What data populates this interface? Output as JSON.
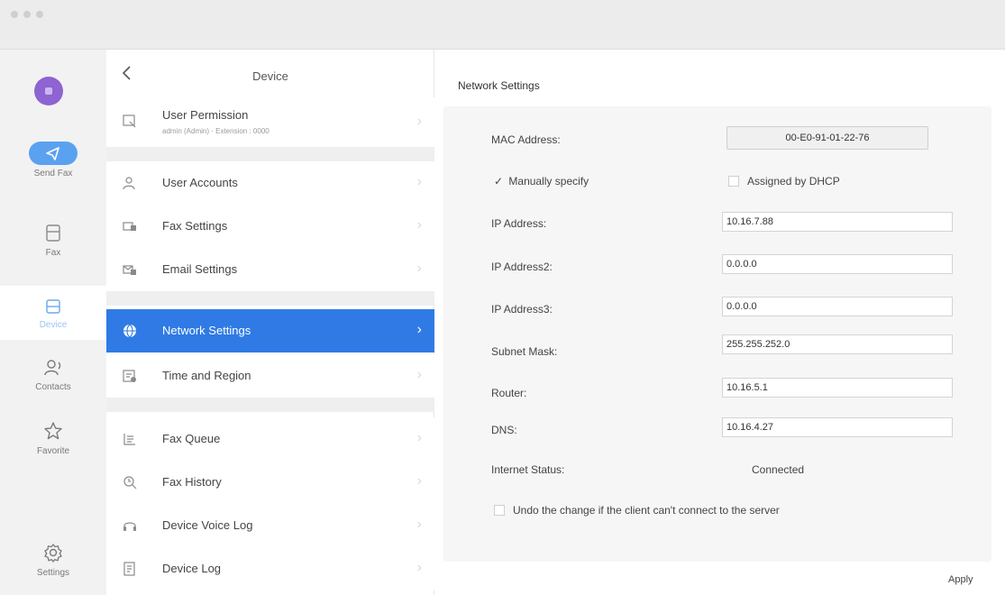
{
  "rail": {
    "send_fax": "Send Fax",
    "fax": "Fax",
    "device": "Device",
    "contacts": "Contacts",
    "favorite": "Favorite",
    "settings": "Settings"
  },
  "menu": {
    "title": "Device",
    "back_icon": "chevron-left-icon",
    "user_permission": {
      "label": "User Permission",
      "sub": "admin (Admin) · Extension : 0000"
    },
    "items": [
      {
        "label": "User Accounts",
        "icon": "user-icon"
      },
      {
        "label": "Fax Settings",
        "icon": "fax-settings-icon"
      },
      {
        "label": "Email Settings",
        "icon": "email-icon"
      },
      {
        "label": "Network Settings",
        "icon": "globe-icon",
        "selected": true
      },
      {
        "label": "Time and Region",
        "icon": "clock-icon"
      },
      {
        "label": "Fax Queue",
        "icon": "queue-icon"
      },
      {
        "label": "Fax History",
        "icon": "history-icon"
      },
      {
        "label": "Device Voice Log",
        "icon": "headset-icon"
      },
      {
        "label": "Device Log",
        "icon": "log-icon"
      }
    ]
  },
  "network": {
    "title": "Network Settings",
    "mac_label": "MAC Address:",
    "mac_value": "00-E0-91-01-22-76",
    "manual_label": "Manually specify",
    "manual_checked": true,
    "dhcp_label": "Assigned by DHCP",
    "dhcp_checked": false,
    "fields": [
      {
        "label": "IP Address:",
        "value": "10.16.7.88"
      },
      {
        "label": "IP Address2:",
        "value": "0.0.0.0"
      },
      {
        "label": "IP Address3:",
        "value": "0.0.0.0"
      },
      {
        "label": "Subnet Mask:",
        "value": "255.255.252.0"
      },
      {
        "label": "Router:",
        "value": "10.16.5.1"
      },
      {
        "label": "DNS:",
        "value": "10.16.4.27"
      }
    ],
    "status_label": "Internet Status:",
    "status_value": "Connected",
    "undo_label": "Undo the change if the client can't connect to the server",
    "undo_checked": false,
    "apply_label": "Apply"
  },
  "colors": {
    "accent": "#2f7ae5",
    "avatar": "#8e63d2",
    "send_fax": "#5aa2f0"
  }
}
